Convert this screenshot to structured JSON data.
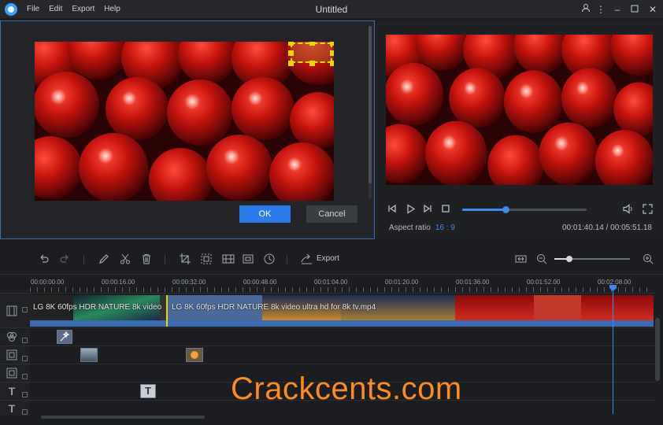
{
  "app": {
    "title": "Untitled",
    "menu": [
      "File",
      "Edit",
      "Export",
      "Help"
    ]
  },
  "crop_dialog": {
    "ok_label": "OK",
    "cancel_label": "Cancel"
  },
  "preview": {
    "aspect_label": "Aspect ratio",
    "aspect_value": "16 : 9",
    "timecode": "00:01:40.14 / 00:05:51.18",
    "progress": 0.35
  },
  "toolbar": {
    "export_label": "Export",
    "zoom_level": 0.2
  },
  "ruler": {
    "labels": [
      "00:00:00.00",
      "00:00:16.00",
      "00:00:32.00",
      "00:00:48.00",
      "00:01:04.00",
      "00:01:20.00",
      "00:01:36.00",
      "00:01:52.00",
      "00:02:08.00"
    ]
  },
  "timeline": {
    "clip_1_label": "LG 8K 60fps HDR NATURE 8k video",
    "clip_2_label": "LG 8K 60fps HDR NATURE 8k video ultra hd for 8k tv.mp4"
  },
  "watermark": "Crackcents.com",
  "colors": {
    "accent": "#3a8ee8",
    "ok_button": "#2b7de9",
    "selection": "#e6d800",
    "watermark": "#ff8a1e"
  },
  "icons": {
    "logo": "app-logo-icon",
    "user": "user-icon",
    "more": "more-icon",
    "minimize": "minimize-icon",
    "maximize": "maximize-icon",
    "close": "close-icon"
  }
}
